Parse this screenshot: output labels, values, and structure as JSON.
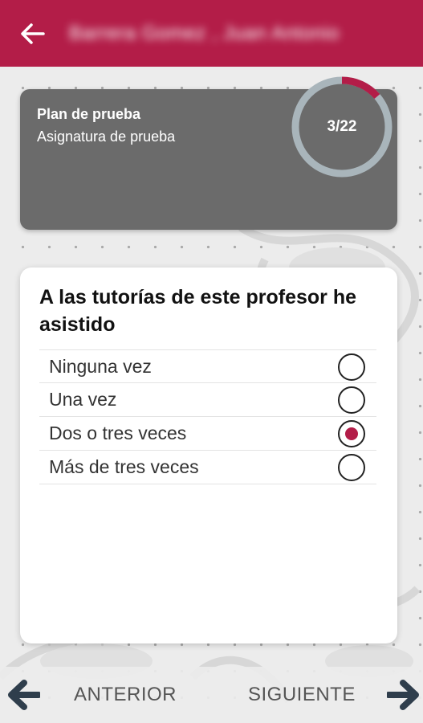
{
  "header": {
    "title": "Barrera Gomez , Juan Antonio",
    "accent_color": "#b31d48",
    "back_icon": "arrow-left-icon"
  },
  "plan": {
    "title": "Plan de prueba",
    "subtitle": "Asignatura de prueba",
    "progress_label": "3/22",
    "progress_current": 3,
    "progress_total": 22
  },
  "question": {
    "text": "A las tutorías de este profesor he asistido",
    "options": [
      {
        "label": "Ninguna vez",
        "selected": false
      },
      {
        "label": "Una vez",
        "selected": false
      },
      {
        "label": "Dos o tres veces",
        "selected": true
      },
      {
        "label": "Más de tres veces",
        "selected": false
      }
    ]
  },
  "navigation": {
    "prev_label": "ANTERIOR",
    "next_label": "SIGUIENTE",
    "prev_icon": "arrow-left-icon",
    "next_icon": "arrow-right-icon"
  }
}
